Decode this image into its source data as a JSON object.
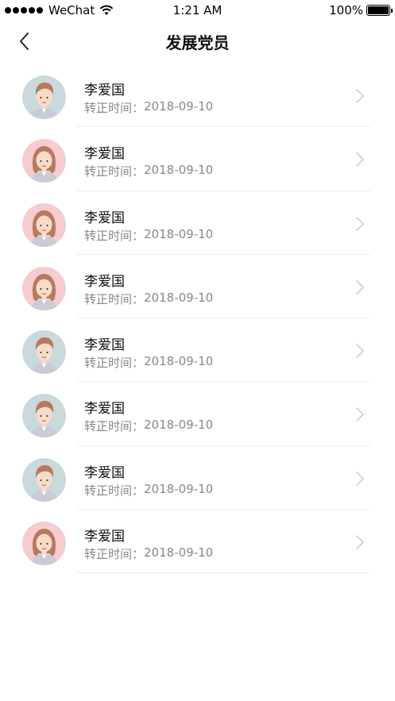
{
  "status_bar": {
    "carrier": "WeChat",
    "time": "1:21 AM",
    "battery": "100%"
  },
  "nav": {
    "title": "发展党员"
  },
  "members": [
    {
      "name": "李爱国",
      "label": "转正时间：",
      "date": "2018-09-10",
      "avatar": "male"
    },
    {
      "name": "李爱国",
      "label": "转正时间：",
      "date": "2018-09-10",
      "avatar": "female"
    },
    {
      "name": "李爱国",
      "label": "转正时间：",
      "date": "2018-09-10",
      "avatar": "female"
    },
    {
      "name": "李爱国",
      "label": "转正时间：",
      "date": "2018-09-10",
      "avatar": "female"
    },
    {
      "name": "李爱国",
      "label": "转正时间：",
      "date": "2018-09-10",
      "avatar": "male"
    },
    {
      "name": "李爱国",
      "label": "转正时间：",
      "date": "2018-09-10",
      "avatar": "male"
    },
    {
      "name": "李爱国",
      "label": "转正时间：",
      "date": "2018-09-10",
      "avatar": "male"
    },
    {
      "name": "李爱国",
      "label": "转正时间：",
      "date": "2018-09-10",
      "avatar": "female"
    }
  ],
  "colors": {
    "male_bg": "#c9d9dc",
    "female_bg": "#f6ccd0",
    "hair": "#b8795f",
    "skin": "#f7dcc9",
    "divider": "#ececec",
    "subtext": "#888888"
  }
}
